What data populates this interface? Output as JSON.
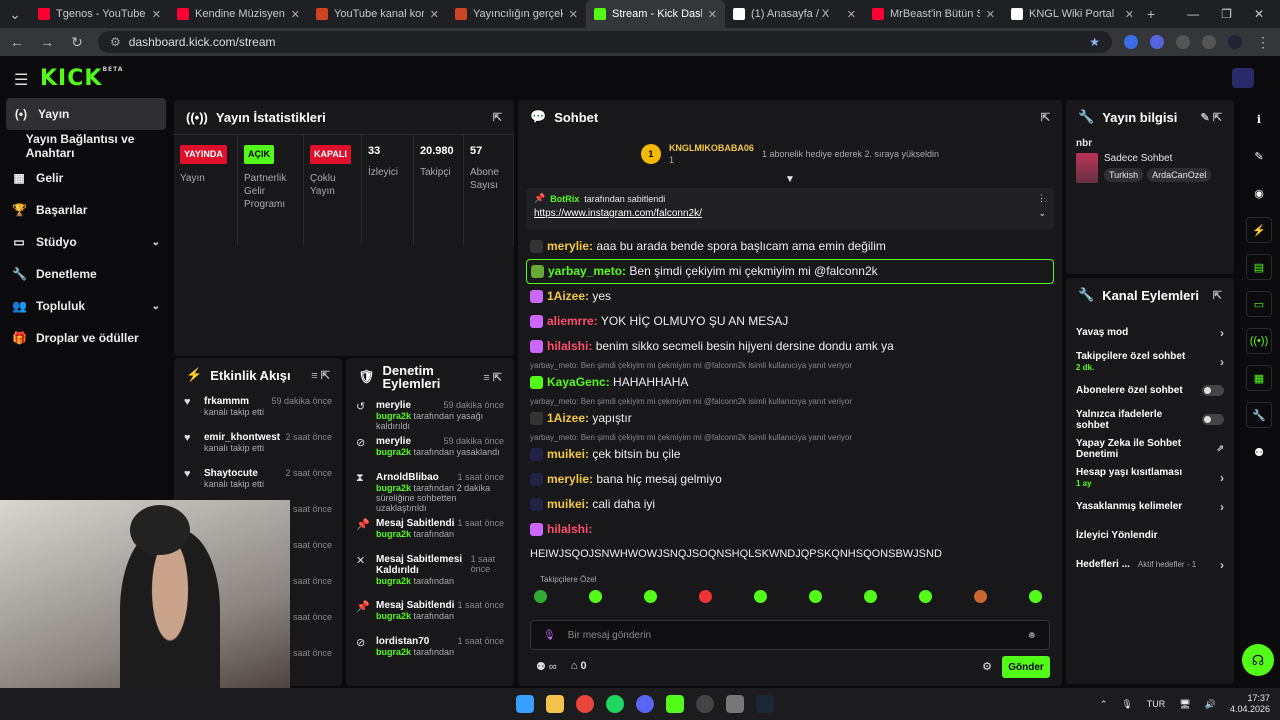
{
  "browser": {
    "tabs": [
      {
        "title": "Tgenos - YouTube",
        "color": "#ff0033"
      },
      {
        "title": "Kendine Müzisyen - YILLA",
        "color": "#ff0033"
      },
      {
        "title": "YouTube kanal konumlan",
        "color": "#cc4422"
      },
      {
        "title": "Yayıncılığın gerçek hazırlı",
        "color": "#cc4422"
      },
      {
        "title": "Stream - Kick Dashboard",
        "color": "#53fc18"
      },
      {
        "title": "(1) Anasayfa / X",
        "color": "#ffffff"
      },
      {
        "title": "MrBeast'in Bütün Stüdyol",
        "color": "#ff0033"
      },
      {
        "title": "KNGL Wiki Portal",
        "color": "#ffffff"
      }
    ],
    "url": "dashboard.kick.com/stream"
  },
  "logo": "KICK",
  "logo_sup": "BETA",
  "sidebar": [
    {
      "label": "Yayın",
      "icon": "(•)"
    },
    {
      "label": "Yayın Bağlantısı ve Anahtarı",
      "icon": ""
    },
    {
      "label": "Gelir",
      "icon": "▦"
    },
    {
      "label": "Başarılar",
      "icon": "🏆"
    },
    {
      "label": "Stüdyo",
      "icon": "▭"
    },
    {
      "label": "Denetleme",
      "icon": "🔧"
    },
    {
      "label": "Topluluk",
      "icon": "👥"
    },
    {
      "label": "Droplar ve ödüller",
      "icon": "🎁"
    }
  ],
  "stats": {
    "title": "Yayın İstatistikleri",
    "cols": [
      {
        "badge": "YAYINDA",
        "color": "#e0102c",
        "label": "Yayın"
      },
      {
        "badge": "AÇIK",
        "color": "#53fc18",
        "label": "Partnerlik Gelir Programı"
      },
      {
        "badge": "KAPALI",
        "color": "#e0102c",
        "label": "Çoklu Yayın"
      },
      {
        "num": "33",
        "label": "İzleyici"
      },
      {
        "num": "20.980",
        "label": "Takipçi"
      },
      {
        "num": "57",
        "label": "Abone Sayısı"
      }
    ]
  },
  "feed": {
    "title": "Etkinlik Akışı",
    "items": [
      {
        "name": "frkammm",
        "time": "59 dakika önce",
        "sub": "kanalı takip etti"
      },
      {
        "name": "emir_khontwest",
        "time": "2 saat önce",
        "sub": "kanalı takip etti"
      },
      {
        "name": "Shaytocute",
        "time": "2 saat önce",
        "sub": "kanalı takip etti"
      },
      {
        "name": "",
        "time": "2 saat önce",
        "sub": ""
      },
      {
        "name": "",
        "time": "5 saat önce",
        "sub": ""
      },
      {
        "name": "",
        "time": "5 saat önce",
        "sub": ""
      },
      {
        "name": "",
        "time": "5 saat önce",
        "sub": ""
      },
      {
        "name": "",
        "time": "5 saat önce",
        "sub": ""
      }
    ]
  },
  "mod": {
    "title": "Denetim Eylemleri",
    "items": [
      {
        "icon": "↺",
        "name": "merylie",
        "time": "59 dakika önce",
        "by": "bugra2k",
        "sub": "tarafından yasağı kaldırıldı"
      },
      {
        "icon": "⊘",
        "name": "merylie",
        "time": "59 dakika önce",
        "by": "bugra2k",
        "sub": "tarafından yasaklandı"
      },
      {
        "icon": "⧗",
        "name": "ArnoldBlibao",
        "time": "1 saat önce",
        "by": "bugra2k",
        "sub": "tarafından 2 dakika süreliğine sohbetten uzaklaştırıldı"
      },
      {
        "icon": "📌",
        "name": "Mesaj Sabitlendi",
        "time": "1 saat önce",
        "by": "bugra2k",
        "sub": "tarafından"
      },
      {
        "icon": "✕",
        "name": "Mesaj Sabitlemesi Kaldırıldı",
        "time": "1 saat önce",
        "by": "bugra2k",
        "sub": "tarafından"
      },
      {
        "icon": "📌",
        "name": "Mesaj Sabitlendi",
        "time": "1 saat önce",
        "by": "bugra2k",
        "sub": "tarafından"
      },
      {
        "icon": "⊘",
        "name": "lordistan70",
        "time": "1 saat önce",
        "by": "bugra2k",
        "sub": "tarafından"
      }
    ]
  },
  "chat": {
    "title": "Sohbet",
    "gift_user": "KNGLMIKOBABA06",
    "gift_count": "1",
    "gift_text": "1 abonelik hediye ederek 2. sıraya yükseldin",
    "pinned_by": "BotRix",
    "pinned_text": "tarafından sabitlendi",
    "pinned_link": "https://www.instagram.com/falconn2k/",
    "messages": [
      {
        "user": "merylie",
        "color": "#f5c842",
        "text": "aaa bu arada bende spora başlıcam ama emin değilim",
        "reply": ""
      },
      {
        "user": "yarbay_meto",
        "color": "#53fc18",
        "text": "Ben şimdi çekiyim mi çekmiyim mi @falconn2k",
        "reply": "",
        "hl": true
      },
      {
        "user": "1Aizee",
        "color": "#f5c842",
        "text": "yes",
        "reply": ""
      },
      {
        "user": "aliemrre",
        "color": "#ff4d6d",
        "text": "YOK HİÇ OLMUYO ŞU AN MESAJ",
        "reply": ""
      },
      {
        "user": "hilalshi",
        "color": "#ff4d6d",
        "text": "benim sikko secmeli besin hijyeni dersine dondu amk ya",
        "reply": ""
      },
      {
        "user": "KayaGenc",
        "color": "#53fc18",
        "text": "HAHAHHAHA",
        "reply": "yarbay_meto: Ben şimdi çekiyim mi çekmiyim mi @falconn2k isimli kullanıcıya yanıt veriyor"
      },
      {
        "user": "1Aizee",
        "color": "#f5c842",
        "text": "yapıştır",
        "reply": "yarbay_meto: Ben şimdi çekiyim mi çekmiyim mi @falconn2k isimli kullanıcıya yanıt veriyor"
      },
      {
        "user": "muikei",
        "color": "#f5c842",
        "text": "çek bitsin bu çile",
        "reply": "yarbay_meto: Ben şimdi çekiyim mi çekmiyim mi @falconn2k isimli kullanıcıya yanıt veriyor"
      },
      {
        "user": "merylie",
        "color": "#f5c842",
        "text": "bana hiç mesaj gelmiyo",
        "reply": ""
      },
      {
        "user": "muikei",
        "color": "#f5c842",
        "text": "cali daha iyi",
        "reply": ""
      },
      {
        "user": "hilalshi",
        "color": "#ff4d6d",
        "text": "",
        "reply": ""
      }
    ],
    "long_msg": "HEIWJSQOJSNWHWOWJSNQJSOQNSHQLSKWNDJQPSKQNHSQONSBWJSND",
    "followers_only": "Takipçilere Özel",
    "input_placeholder": "Bir mesaj gönderin",
    "points": "0",
    "send": "Gönder"
  },
  "info": {
    "title": "Yayın bilgisi",
    "user": "nbr",
    "category": "Sadece Sohbet",
    "tags": [
      "Turkish",
      "ArdaCanOzel"
    ]
  },
  "actions": {
    "title": "Kanal Eylemleri",
    "items": [
      {
        "label": "Yavaş mod",
        "sub": "",
        "type": "arrow"
      },
      {
        "label": "Takipçilere özel sohbet",
        "sub": "2 dk.",
        "type": "arrow"
      },
      {
        "label": "Abonelere özel sohbet",
        "sub": "",
        "type": "toggle"
      },
      {
        "label": "Yalnızca ifadelerle sohbet",
        "sub": "",
        "type": "toggle"
      },
      {
        "label": "Yapay Zeka ile Sohbet Denetimi",
        "sub": "",
        "type": "ext"
      },
      {
        "label": "Hesap yaşı kısıtlaması",
        "sub": "1 ay",
        "type": "arrow"
      },
      {
        "label": "Yasaklanmış kelimeler",
        "sub": "",
        "type": "arrow"
      },
      {
        "label": "İzleyici Yönlendir",
        "sub": "",
        "type": "none"
      },
      {
        "label": "Hedefleri ...",
        "sub": "Aktif hedefler - 1",
        "type": "arrow"
      }
    ]
  },
  "taskbar": {
    "lang": "TUR",
    "time": "17:37",
    "date": "4.04.2026"
  }
}
